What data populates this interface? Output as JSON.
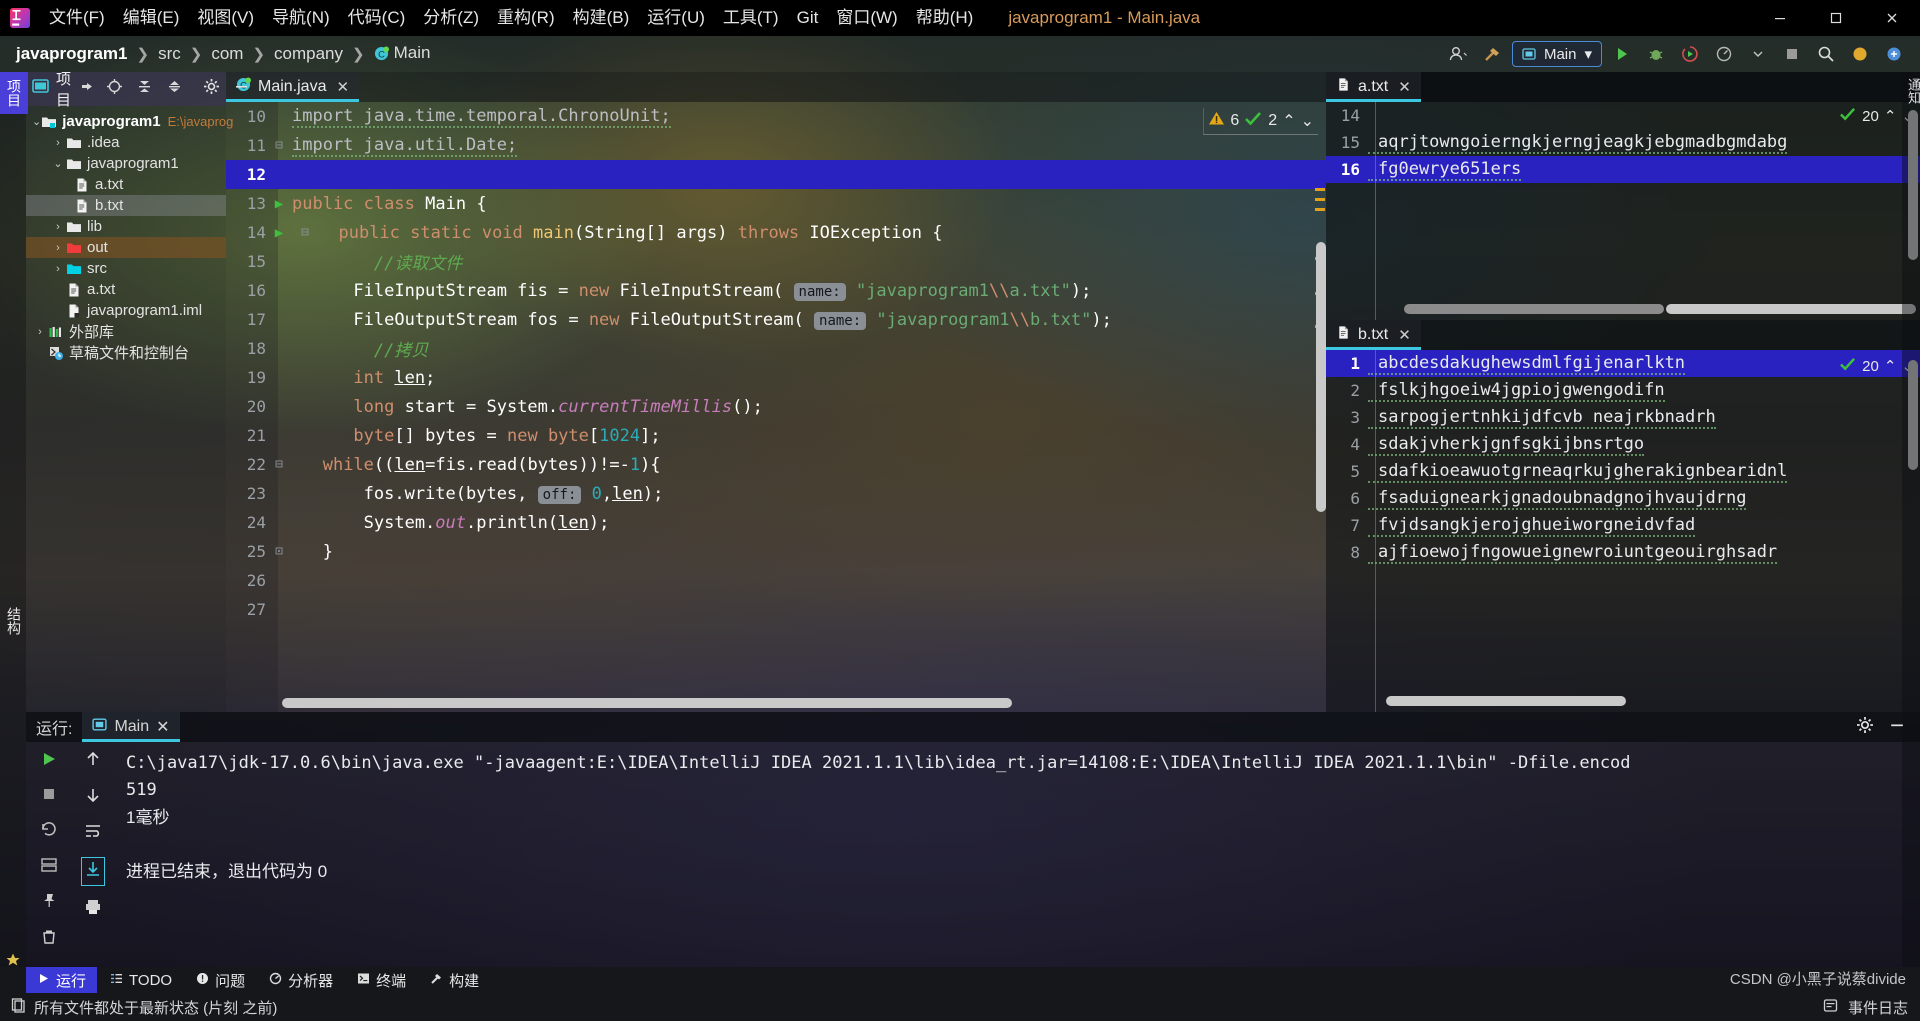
{
  "window": {
    "title": "javaprogram1 - Main.java",
    "minimize": "–",
    "maximize": "□",
    "close": "✕"
  },
  "menu": {
    "items": [
      {
        "label": "文件(F)",
        "name": "menu-file"
      },
      {
        "label": "编辑(E)",
        "name": "menu-edit"
      },
      {
        "label": "视图(V)",
        "name": "menu-view"
      },
      {
        "label": "导航(N)",
        "name": "menu-navigate"
      },
      {
        "label": "代码(C)",
        "name": "menu-code"
      },
      {
        "label": "分析(Z)",
        "name": "menu-analyze"
      },
      {
        "label": "重构(R)",
        "name": "menu-refactor"
      },
      {
        "label": "构建(B)",
        "name": "menu-build"
      },
      {
        "label": "运行(U)",
        "name": "menu-run"
      },
      {
        "label": "工具(T)",
        "name": "menu-tools"
      },
      {
        "label": "Git",
        "name": "menu-git"
      },
      {
        "label": "窗口(W)",
        "name": "menu-window"
      },
      {
        "label": "帮助(H)",
        "name": "menu-help"
      }
    ]
  },
  "breadcrumb": {
    "sep": "❯",
    "items": [
      "javaprogram1",
      "src",
      "com",
      "company",
      "Main"
    ]
  },
  "toolbar": {
    "run_config": "Main",
    "dropdown_caret": "▾"
  },
  "left_strip": {
    "project_tab": "项目",
    "structure_tab": "结构",
    "bookmarks_tab": "收藏夹"
  },
  "right_strip": {
    "notifications_tab": "通知"
  },
  "project_panel": {
    "title": "项目",
    "tree": [
      {
        "label": "javaprogram1",
        "path": "E:\\javaprog",
        "depth": 0,
        "chev": "⌄",
        "icon": "module-folder-icon",
        "bold": true,
        "state": "none"
      },
      {
        "label": ".idea",
        "depth": 1,
        "chev": "›",
        "icon": "folder-icon",
        "state": "none"
      },
      {
        "label": "javaprogram1",
        "depth": 1,
        "chev": "⌄",
        "icon": "folder-icon",
        "state": "none"
      },
      {
        "label": "a.txt",
        "depth": 2,
        "chev": "",
        "icon": "file-text-icon",
        "state": "none"
      },
      {
        "label": "b.txt",
        "depth": 2,
        "chev": "",
        "icon": "file-text-icon",
        "state": "selected"
      },
      {
        "label": "lib",
        "depth": 1,
        "chev": "›",
        "icon": "folder-icon",
        "state": "none"
      },
      {
        "label": "out",
        "depth": 1,
        "chev": "›",
        "icon": "folder-red-icon",
        "state": "highlighted"
      },
      {
        "label": "src",
        "depth": 1,
        "chev": "›",
        "icon": "folder-source-icon",
        "state": "none"
      },
      {
        "label": "a.txt",
        "depth": 1,
        "chev": "",
        "icon": "file-text-icon",
        "state": "none"
      },
      {
        "label": "javaprogram1.iml",
        "depth": 1,
        "chev": "",
        "icon": "file-iml-icon",
        "state": "none"
      },
      {
        "label": "外部库",
        "depth": 0,
        "chev": "›",
        "icon": "library-icon",
        "state": "none"
      },
      {
        "label": "草稿文件和控制台",
        "depth": 0,
        "chev": "",
        "icon": "scratches-icon",
        "state": "none"
      }
    ]
  },
  "editor": {
    "tab": {
      "label": "Main.java",
      "close": "✕",
      "icon": "java-class-icon"
    },
    "inspections": {
      "warning_count": "6",
      "ok_count": "2",
      "up": "⌃",
      "down": "⌄"
    },
    "lines": [
      {
        "n": "10",
        "mark": "",
        "fold": "",
        "current": false
      },
      {
        "n": "11",
        "mark": "",
        "fold": "⊟",
        "current": false
      },
      {
        "n": "12",
        "mark": "",
        "fold": "",
        "current": true
      },
      {
        "n": "13",
        "mark": "▶",
        "fold": "",
        "current": false
      },
      {
        "n": "14",
        "mark": "▶",
        "fold": "⊟",
        "current": false
      },
      {
        "n": "15",
        "mark": "",
        "fold": "",
        "current": false
      },
      {
        "n": "16",
        "mark": "",
        "fold": "",
        "current": false
      },
      {
        "n": "17",
        "mark": "",
        "fold": "",
        "current": false
      },
      {
        "n": "18",
        "mark": "",
        "fold": "",
        "current": false
      },
      {
        "n": "19",
        "mark": "",
        "fold": "",
        "current": false
      },
      {
        "n": "20",
        "mark": "",
        "fold": "",
        "current": false
      },
      {
        "n": "21",
        "mark": "",
        "fold": "",
        "current": false
      },
      {
        "n": "22",
        "mark": "",
        "fold": "⊟",
        "current": false
      },
      {
        "n": "23",
        "mark": "",
        "fold": "",
        "current": false
      },
      {
        "n": "24",
        "mark": "",
        "fold": "",
        "current": false
      },
      {
        "n": "25",
        "mark": "",
        "fold": "⊡",
        "current": false
      },
      {
        "n": "26",
        "mark": "",
        "fold": "",
        "current": false
      },
      {
        "n": "27",
        "mark": "",
        "fold": "",
        "current": false
      }
    ],
    "source_text": [
      "import java.time.temporal.ChronoUnit;",
      "import java.util.Date;",
      "",
      "public class Main {",
      "    public static void main(String[] args) throws IOException {",
      "        //读取文件",
      "        FileInputStream fis = new FileInputStream( name: \"javaprogram1\\\\a.txt\");",
      "        FileOutputStream fos = new FileOutputStream( name: \"javaprogram1\\\\b.txt\");",
      "        //拷贝",
      "        int len;",
      "        long start = System.currentTimeMillis();",
      "        byte[] bytes = new byte[1024];",
      "        while((len=fis.read(bytes))!=-1){",
      "            fos.write(bytes, off: 0,len);",
      "            System.out.println(len);",
      "        }",
      "",
      ""
    ]
  },
  "atxt_panel": {
    "tab": {
      "label": "a.txt",
      "close": "✕",
      "icon": "file-text-icon"
    },
    "inspections": {
      "ok_count": "20",
      "up": "⌃",
      "down": "⌄"
    },
    "lines": [
      {
        "n": "14",
        "text": "",
        "current": false
      },
      {
        "n": "15",
        "text": "aqrjtowngoierngkjerngjeagkjebgmadbgmdabg",
        "current": false
      },
      {
        "n": "16",
        "text": "fg0ewrye651ers",
        "current": true
      }
    ]
  },
  "btxt_panel": {
    "tab": {
      "label": "b.txt",
      "close": "✕",
      "icon": "file-text-icon"
    },
    "inspections": {
      "ok_count": "20",
      "up": "⌃",
      "down": "⌄"
    },
    "lines": [
      {
        "n": "1",
        "text": "abcdesdakughewsdmlfgijenarlktn",
        "current": true
      },
      {
        "n": "2",
        "text": "fslkjhgoeiw4jgpiojgwengodifn",
        "current": false
      },
      {
        "n": "3",
        "text": "sarpogjertnhkijdfcvb neajrkbnadrh",
        "current": false
      },
      {
        "n": "4",
        "text": "sdakjvherkjgnfsgkijbnsrtgo",
        "current": false
      },
      {
        "n": "5",
        "text": "sdafkioeawuotgrneaqrkujgherakignbearidnl",
        "current": false
      },
      {
        "n": "6",
        "text": "fsaduignearkjgnadoubnadgnojhvaujdrng",
        "current": false
      },
      {
        "n": "7",
        "text": "fvjdsangkjerojghueiworgneidvfad",
        "current": false
      },
      {
        "n": "8",
        "text": "ajfioewojfngowueignewroiuntgeouirghsadr",
        "current": false
      }
    ]
  },
  "run_window": {
    "label": "运行:",
    "tab": {
      "label": "Main",
      "close": "✕",
      "icon": "run-config-icon"
    },
    "settings_icon": "⚙",
    "minimize_icon": "—",
    "console_lines": [
      "C:\\java17\\jdk-17.0.6\\bin\\java.exe \"-javaagent:E:\\IDEA\\IntelliJ IDEA 2021.1.1\\lib\\idea_rt.jar=14108:E:\\IDEA\\IntelliJ IDEA 2021.1.1\\bin\" -Dfile.encod",
      "519",
      "1毫秒",
      "",
      "进程已结束，退出代码为 0"
    ],
    "side_labels": {
      "debug": "结构",
      "favorites": "收藏"
    }
  },
  "bottom_toolbar": {
    "items": [
      {
        "label": "运行",
        "icon": "run-icon",
        "active": true,
        "name": "bottom-tab-run"
      },
      {
        "label": "TODO",
        "icon": "todo-icon",
        "active": false,
        "name": "bottom-tab-todo"
      },
      {
        "label": "问题",
        "icon": "problems-icon",
        "active": false,
        "name": "bottom-tab-problems"
      },
      {
        "label": "分析器",
        "icon": "profiler-icon",
        "active": false,
        "name": "bottom-tab-profiler"
      },
      {
        "label": "终端",
        "icon": "terminal-icon",
        "active": false,
        "name": "bottom-tab-terminal"
      },
      {
        "label": "构建",
        "icon": "build-icon",
        "active": false,
        "name": "bottom-tab-build"
      }
    ]
  },
  "status_bar": {
    "message": "所有文件都处于最新状态 (片刻 之前)",
    "event_log": "事件日志"
  },
  "watermark": "CSDN @小黑子说蔡divide"
}
